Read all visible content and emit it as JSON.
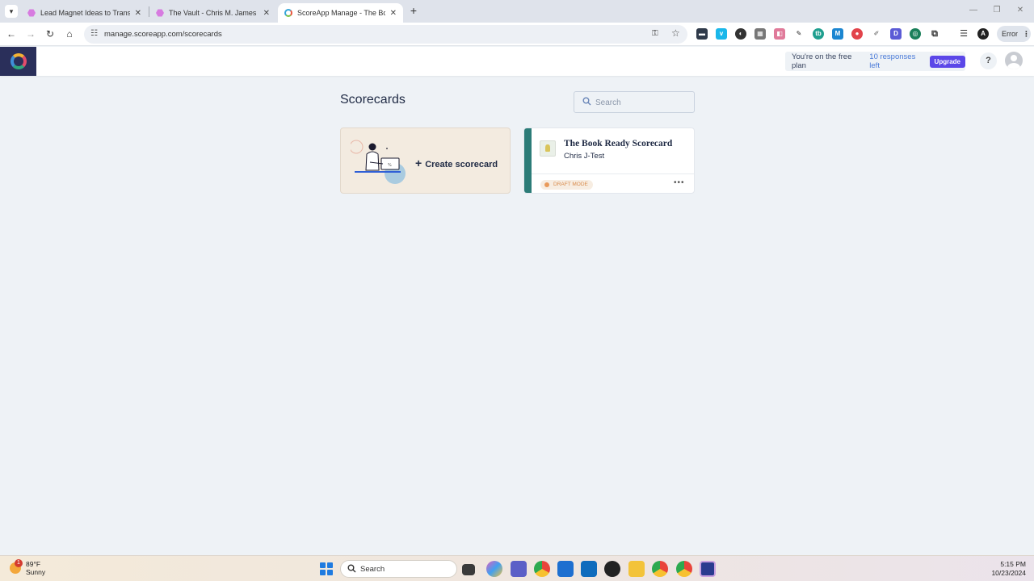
{
  "browser": {
    "tabs": [
      {
        "title": "Lead Magnet Ideas to Transform"
      },
      {
        "title": "The Vault - Chris M. James"
      },
      {
        "title": "ScoreApp Manage - The Book R"
      }
    ],
    "new_tab_symbol": "+",
    "url": "manage.scoreapp.com/scorecards",
    "profile_status": "Error"
  },
  "header": {
    "plan_text": "You're on the free plan",
    "responses_left": "10 responses left",
    "upgrade_label": "Upgrade",
    "help_label": "?"
  },
  "main": {
    "title": "Scorecards",
    "search_placeholder": "Search",
    "create_card_label": "Create scorecard",
    "scorecards": [
      {
        "title": "The Book Ready Scorecard",
        "subtitle": "Chris J-Test",
        "status": "DRAFT MODE"
      }
    ]
  },
  "taskbar": {
    "weather_temp": "89°F",
    "weather_condition": "Sunny",
    "weather_badge": "1",
    "search_label": "Search",
    "time": "5:15 PM",
    "date": "10/23/2024"
  },
  "colors": {
    "accent": "#5b47e8",
    "scorecard_accent": "#2c7c78",
    "draft": "#d88a4a",
    "create_card_bg": "#f3ebe0"
  }
}
